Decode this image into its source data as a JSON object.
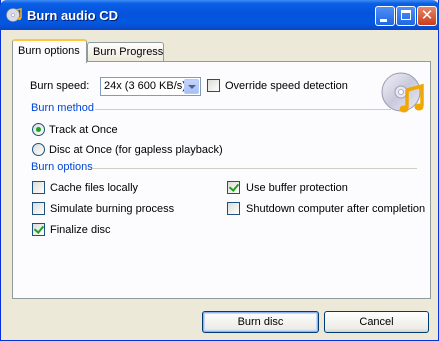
{
  "window": {
    "title": "Burn audio CD",
    "close_glyph": "✕"
  },
  "tabs": [
    {
      "label": "Burn options",
      "active": true
    },
    {
      "label": "Burn Progress",
      "active": false
    }
  ],
  "speed": {
    "label": "Burn speed:",
    "value": "24x (3 600 KB/s)",
    "override_label": "Override speed detection",
    "override_checked": false
  },
  "method": {
    "group_label": "Burn method",
    "options": [
      {
        "label": "Track at Once",
        "selected": true
      },
      {
        "label": "Disc at Once (for gapless playback)",
        "selected": false
      }
    ]
  },
  "options": {
    "group_label": "Burn options",
    "cache_label": "Cache files locally",
    "cache_checked": false,
    "simulate_label": "Simulate burning process",
    "simulate_checked": false,
    "finalize_label": "Finalize disc",
    "finalize_checked": true,
    "buffer_label": "Use buffer protection",
    "buffer_checked": true,
    "shutdown_label": "Shutdown computer after completion",
    "shutdown_checked": false
  },
  "buttons": {
    "burn": "Burn disc",
    "cancel": "Cancel"
  },
  "icons": {
    "title": "cd-music-icon",
    "main": "cd-music-note-icon"
  },
  "colors": {
    "title_bar": "#0553dc",
    "group_label": "#0046d5",
    "check": "#21a121"
  }
}
